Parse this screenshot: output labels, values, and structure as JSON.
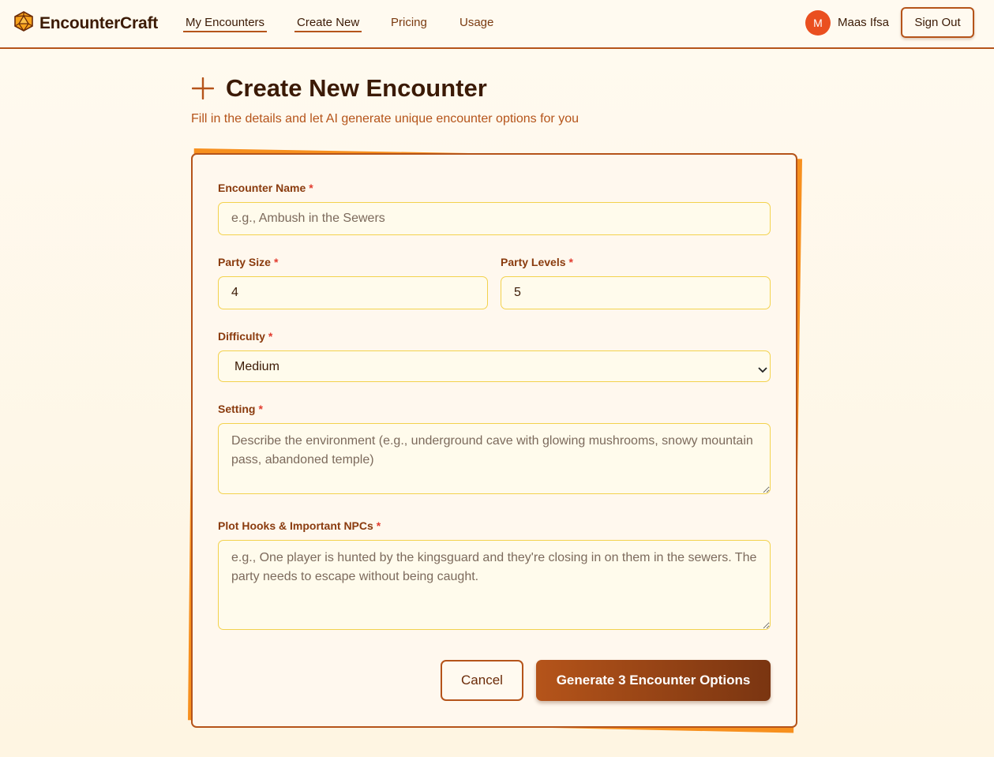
{
  "app": {
    "name": "EncounterCraft"
  },
  "nav": {
    "links": [
      {
        "label": "My Encounters"
      },
      {
        "label": "Create New"
      },
      {
        "label": "Pricing"
      },
      {
        "label": "Usage"
      }
    ],
    "user": {
      "initial": "M",
      "name": "Maas Ifsa"
    },
    "sign_out_label": "Sign Out"
  },
  "page": {
    "title": "Create New Encounter",
    "subtitle": "Fill in the details and let AI generate unique encounter options for you"
  },
  "form": {
    "required_marker": "*",
    "encounter_name": {
      "label": "Encounter Name",
      "value": "",
      "placeholder": "e.g., Ambush in the Sewers"
    },
    "party_size": {
      "label": "Party Size",
      "value": "4"
    },
    "party_levels": {
      "label": "Party Levels",
      "value": "5"
    },
    "difficulty": {
      "label": "Difficulty",
      "selected": "Medium"
    },
    "setting": {
      "label": "Setting",
      "value": "",
      "placeholder": "Describe the environment (e.g., underground cave with glowing mushrooms, snowy mountain pass, abandoned temple)"
    },
    "plot_hooks": {
      "label": "Plot Hooks & Important NPCs",
      "value": "",
      "placeholder": "e.g., One player is hunted by the kingsguard and they're closing in on them in the sewers. The party needs to escape without being caught."
    },
    "cancel_label": "Cancel",
    "generate_label": "Generate 3 Encounter Options"
  },
  "colors": {
    "accent": "#b5541a",
    "card_shadow": "#f7901e",
    "avatar": "#ea4f1f",
    "required": "#e23b2e",
    "field_border": "#f3d24d"
  },
  "icons": {
    "logo": "d20-icon",
    "title": "plus-icon",
    "select": "chevron-down-icon"
  }
}
